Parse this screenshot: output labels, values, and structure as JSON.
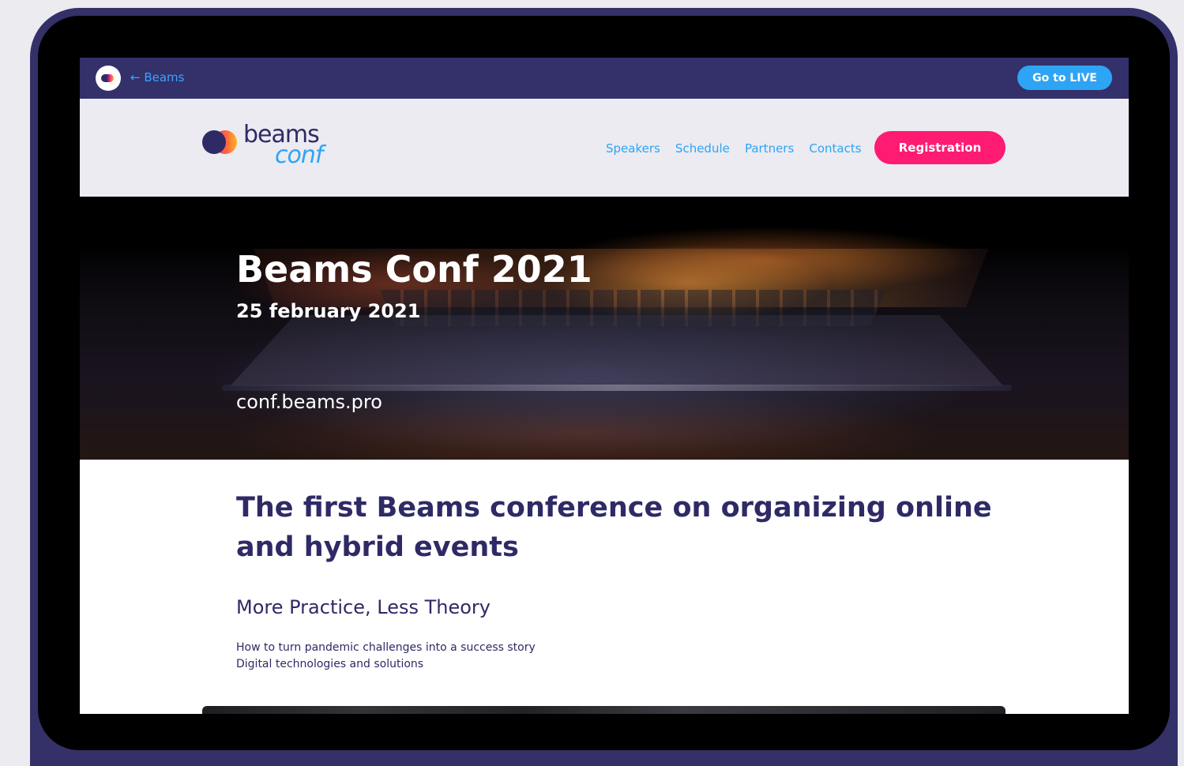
{
  "appbar": {
    "back_label": "← Beams",
    "live_button": "Go to LIVE"
  },
  "header": {
    "brand_line1": "beams",
    "brand_line2": "conf",
    "nav": [
      "Speakers",
      "Schedule",
      "Partners",
      "Contacts"
    ],
    "registration_button": "Registration"
  },
  "hero": {
    "title": "Beams Conf 2021",
    "date": "25 february 2021",
    "url": "conf.beams.pro"
  },
  "content": {
    "headline": "The first Beams conference on organizing online and hybrid events",
    "subheadline": "More Practice, Less Theory",
    "points": [
      "How to turn pandemic challenges into a success story",
      "Digital technologies and solutions"
    ]
  },
  "colors": {
    "device_frame": "#343068",
    "appbar": "#33306a",
    "accent_blue": "#2ea4f5",
    "accent_pink": "#ff1a72",
    "brand_navy": "#2e2a66"
  }
}
